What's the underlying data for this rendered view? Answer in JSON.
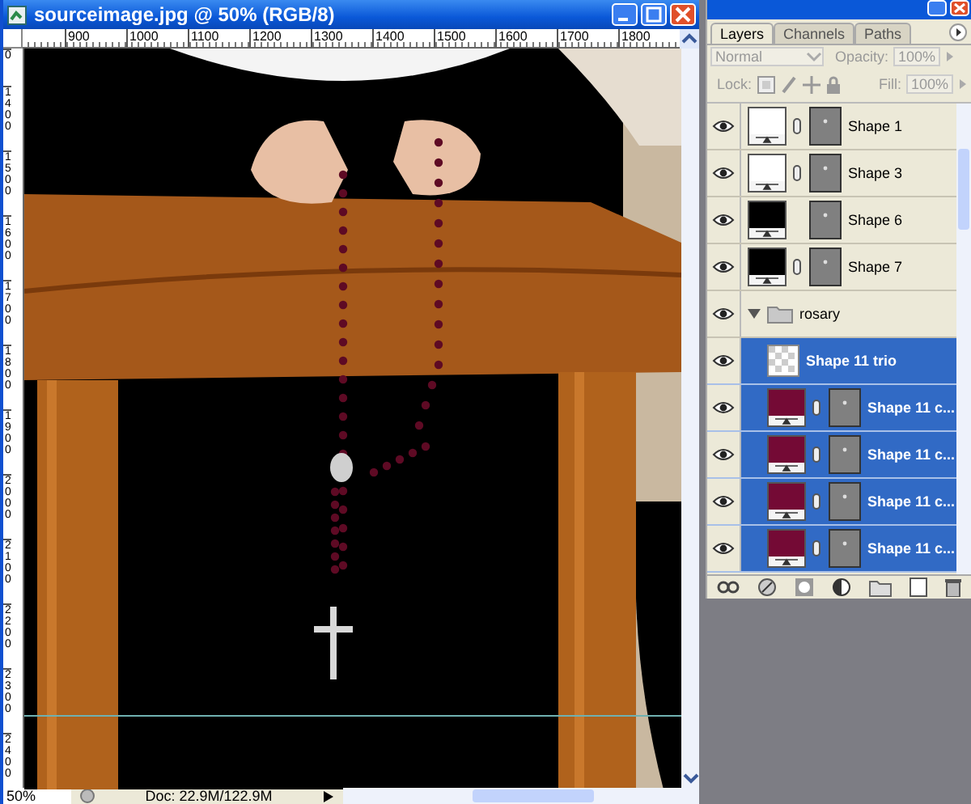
{
  "document_window": {
    "title": "sourceimage.jpg @ 50% (RGB/8)"
  },
  "rulers": {
    "horizontal": [
      "900",
      "1000",
      "1100",
      "1200",
      "1300",
      "1400",
      "1500",
      "1600",
      "1700",
      "1800"
    ],
    "vertical": [
      "0",
      "1400",
      "1500",
      "1600",
      "1700",
      "1800",
      "1900",
      "2000",
      "2100",
      "2200",
      "2300",
      "2400"
    ]
  },
  "status_bar": {
    "zoom": "50%",
    "document_size": "Doc: 22.9M/122.9M"
  },
  "layers_panel": {
    "tabs": [
      {
        "label": "Layers",
        "selected": true
      },
      {
        "label": "Channels",
        "selected": false
      },
      {
        "label": "Paths",
        "selected": false
      }
    ],
    "blend_mode": "Normal",
    "opacity_label": "Opacity:",
    "opacity": "100%",
    "lock_label": "Lock:",
    "fill_label": "Fill:",
    "fill": "100%",
    "layers": [
      {
        "name": "Shape 1",
        "kind": "shape",
        "color": "#ffffff",
        "linked": true,
        "visible": true,
        "selected": false
      },
      {
        "name": "Shape 3",
        "kind": "shape",
        "color": "#ffffff",
        "linked": true,
        "visible": true,
        "selected": false
      },
      {
        "name": "Shape 6",
        "kind": "shape",
        "color": "#000000",
        "linked": false,
        "visible": true,
        "selected": false
      },
      {
        "name": "Shape 7",
        "kind": "shape",
        "color": "#000000",
        "linked": true,
        "visible": true,
        "selected": false
      },
      {
        "name": "rosary",
        "kind": "group",
        "expanded": true,
        "visible": true,
        "selected": false,
        "children": [
          {
            "name": "Shape 11 trio",
            "kind": "raster",
            "visible": true,
            "selected": true
          },
          {
            "name": "Shape 11 c...",
            "kind": "shape",
            "color": "#740a35",
            "linked": true,
            "visible": true,
            "selected": true
          },
          {
            "name": "Shape 11 c...",
            "kind": "shape",
            "color": "#740a35",
            "linked": true,
            "visible": true,
            "selected": true
          },
          {
            "name": "Shape 11 c...",
            "kind": "shape",
            "color": "#740a35",
            "linked": true,
            "visible": true,
            "selected": true
          },
          {
            "name": "Shape 11 c...",
            "kind": "shape",
            "color": "#740a35",
            "linked": true,
            "visible": true,
            "selected": true
          }
        ]
      }
    ]
  }
}
